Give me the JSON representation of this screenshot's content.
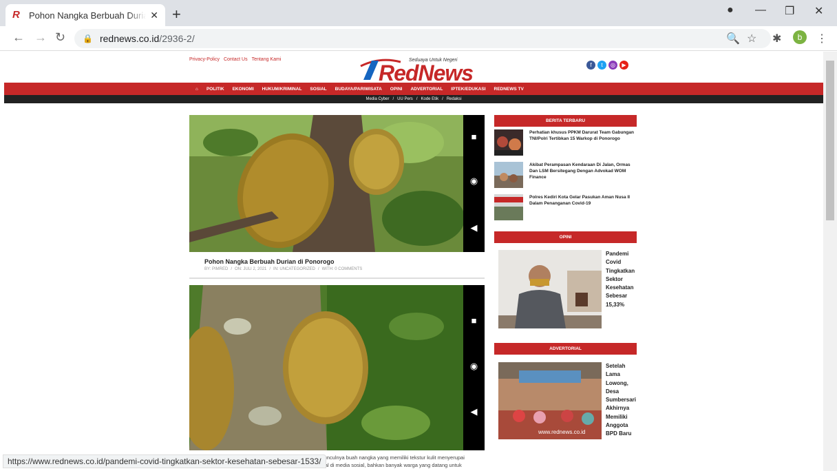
{
  "browser": {
    "tab_title": "Pohon Nangka Berbuah Durian di Ponorogo",
    "tab_favicon": "R",
    "tab_close": "✕",
    "new_tab": "+",
    "url_host": "rednews.co.id",
    "url_path": "/2936-2/",
    "profile_initial": "b",
    "status_url": "https://www.rednews.co.id/pandemi-covid-tingkatkan-sektor-kesehatan-sebesar-1533/"
  },
  "header": {
    "links": [
      "Privacy-Policy",
      "Contact Us",
      "Tentang Kami"
    ],
    "logo_word": "RedNews",
    "logo_tagline": "Seduaya Untuk Negeri",
    "social": [
      "facebook-icon",
      "twitter-icon",
      "instagram-icon",
      "youtube-icon"
    ]
  },
  "nav": {
    "items": [
      "POLITIK",
      "EKONOMI",
      "HUKUM/KRIMINAL",
      "SOSIAL",
      "BUDAYA/PARIWISATA",
      "OPINI",
      "ADVERTORIAL",
      "IPTEK/EDUKASI",
      "REDNEWS TV"
    ],
    "sub": [
      "Media Cyber",
      "/",
      "UU Pers",
      "/",
      "Kode Etik",
      "/",
      "Redaksi"
    ]
  },
  "post": {
    "title": "Pohon Nangka Berbuah Durian di Ponorogo",
    "by": "BY: PIMRED",
    "on": "ON: JULI 2, 2021",
    "in": "IN: UNCATEGORIZED",
    "with": "WITH: 0 COMMENTS",
    "excerpt_line1": "hkan munculnya buah nangka yang memiliki tekstur kulit menyerupai",
    "excerpt_line2": "njadi viral di media sosial, bahkan banyak warga yang datang untuk"
  },
  "sidebar": {
    "berita_heading": "BERITA TERBARU",
    "news": [
      "Perhatian khusus PPKM Darurat Team Gabungan TNI/Polri Tertibkan 15 Warkop di Ponorogo",
      "Akibat Perampasan Kendaraan Di Jalan, Ormas Dan LSM Bersitegang Dengan Advokad WOM Finance",
      "Polres Kediri Kota Gelar Pasukan Aman Nusa II Dalam Penanganan Covid-19"
    ],
    "opini_heading": "OPINI",
    "opini_caption": "Pandemi Covid Tingkatkan Sektor Kesehatan Sebesar 15,33%",
    "advertorial_heading": "ADVERTORIAL",
    "advertorial_caption": "Setelah Lama Lowong, Desa Sumbersari Akhirnya Memiliki Anggota BPD Baru",
    "advertorial_watermark": "www.rednews.co.id"
  },
  "colors": {
    "brand_red": "#c62828",
    "brand_blue": "#1565c0"
  }
}
